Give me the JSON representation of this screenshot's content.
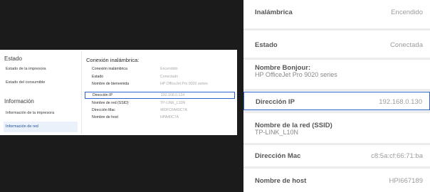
{
  "left": {
    "sidebar": {
      "section_status": "Estado",
      "item_printer_status": "Estado de la impresora",
      "item_supply_status": "Estado del consumible",
      "section_info": "Información",
      "item_printer_info": "Información de la impresora",
      "item_network_info": "Información de red"
    },
    "main": {
      "title": "Conexión inalámbrica:",
      "rows": [
        {
          "key": "Conexión inalámbrica",
          "value": "Encendido"
        },
        {
          "key": "Estado",
          "value": "Conectado"
        },
        {
          "key": "Nombre de bienvenida",
          "value": "HP OfficeJet Pro 9020 series"
        },
        {
          "key": "Dirección IP",
          "value": "192.168.0.124"
        },
        {
          "key": "Nombre de red (SSID)",
          "value": "TP-LINK_L10N"
        },
        {
          "key": "Dirección Mac",
          "value": "480FCFA40C7A"
        },
        {
          "key": "Nombre de host",
          "value": "HPA40C7A"
        }
      ]
    }
  },
  "right": {
    "wireless_label": "Inalámbrica",
    "wireless_value": "Encendido",
    "status_label": "Estado",
    "status_value": "Conectada",
    "bonjour_label": "Nombre Bonjour:",
    "bonjour_value": "HP OfficeJet Pro 9020 series",
    "ip_label": "Dirección IP",
    "ip_value": "192.168.0.130",
    "ssid_label": "Nombre de la red (SSID)",
    "ssid_value": "TP-LINK_L10N",
    "mac_label": "Dirección Mac",
    "mac_value": "c8:5a:cf:66:71:ba",
    "host_label": "Nombre de host",
    "host_value": "HPI667189"
  },
  "colors": {
    "highlight": "#2e63c8",
    "dark_background": "#1b1b1b",
    "value_gray": "#9c9c9c"
  }
}
